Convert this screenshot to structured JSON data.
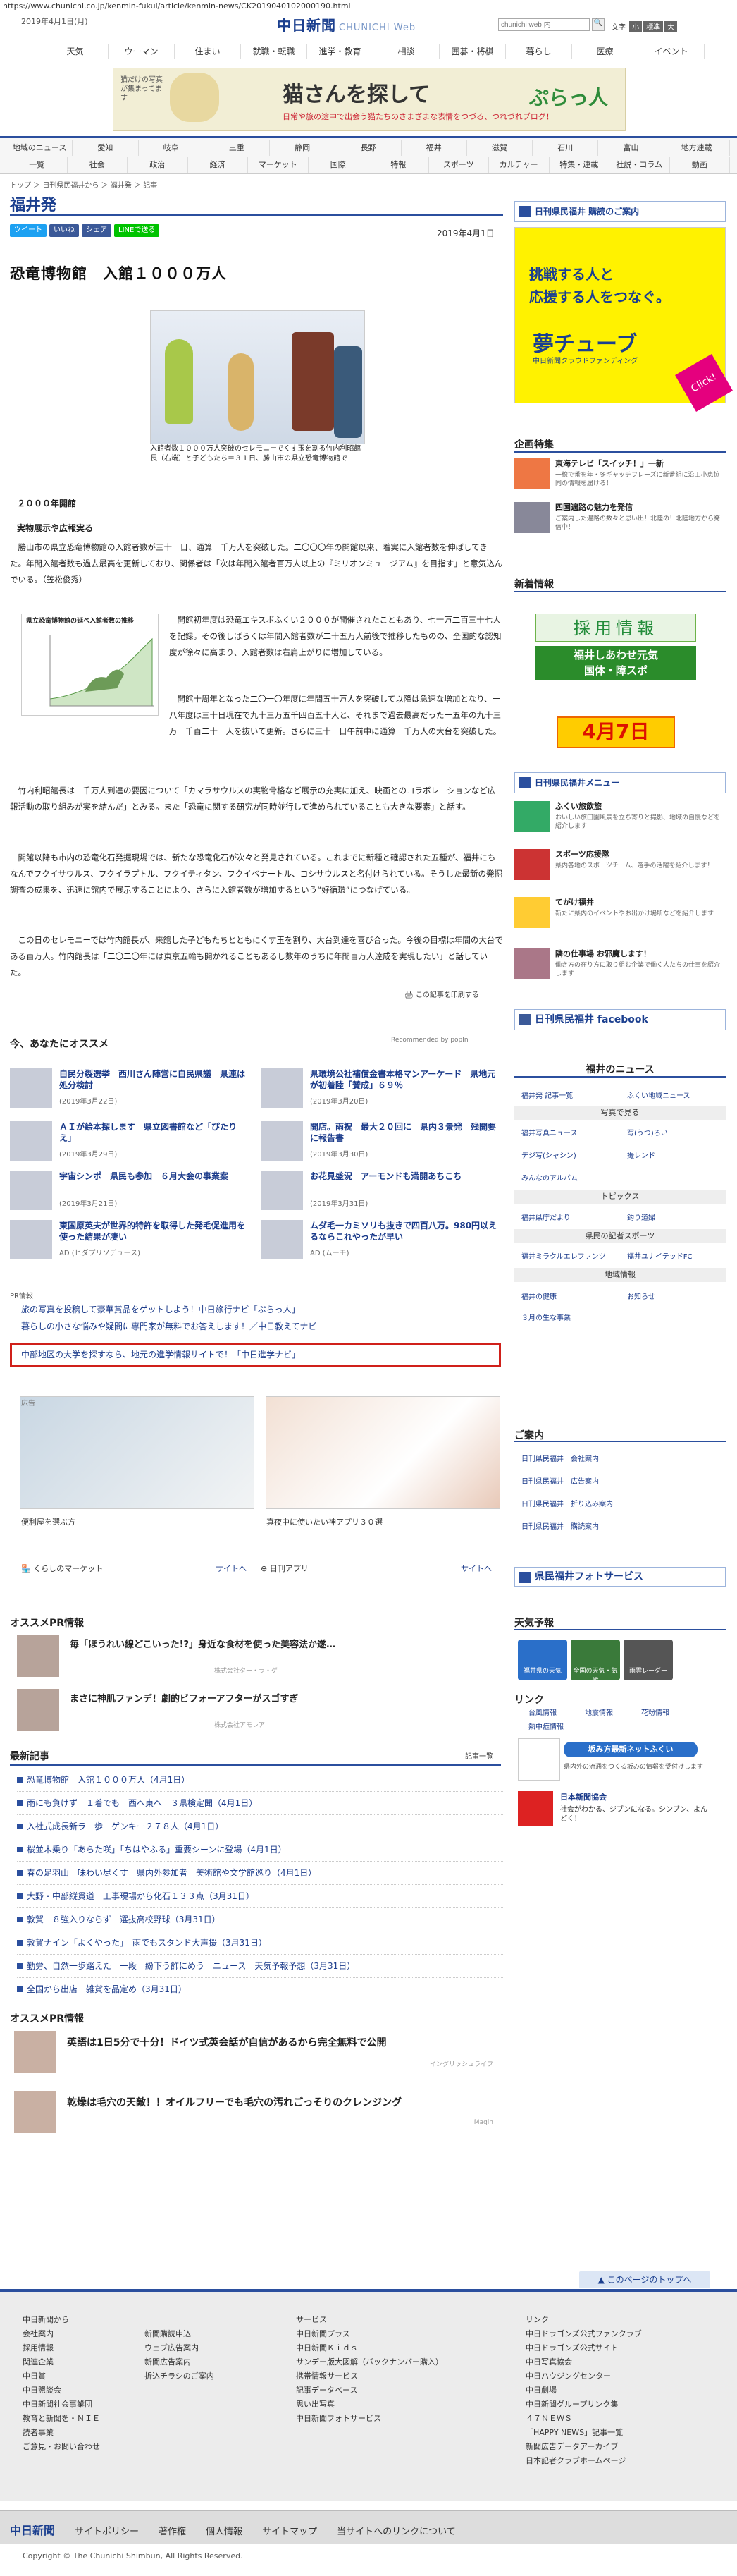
{
  "browser": {
    "url": "https://www.chunichi.co.jp/kenmin-fukui/article/kenmin-news/CK2019040102000190.html"
  },
  "header": {
    "date": "2019年4月1日(月)",
    "logo": "中日新聞",
    "logo_sub": "CHUNICHI Web",
    "search_placeholder": "chunichi web 内",
    "search_btn": "🔍",
    "font_size_label": "文字",
    "font_small": "小",
    "font_std": "標準",
    "font_large": "大",
    "nav": [
      "天気",
      "ウーマン",
      "住まい",
      "就職・転職",
      "進学・教育",
      "相談",
      "囲碁・将棋",
      "暮らし",
      "医療",
      "イベント"
    ]
  },
  "banner": {
    "badge": "猫だけの写真が集まってます",
    "title": "猫さんを探して",
    "sub": "日常や旅の途中で出会う猫たちのさまざまな表情をつづる、つれづれブログ！",
    "brand": "ぷらっ人"
  },
  "region_nav": {
    "row1": [
      "地域のニュース",
      "愛知",
      "岐阜",
      "三重",
      "静岡",
      "長野",
      "福井",
      "滋賀",
      "石川",
      "富山",
      "地方連載"
    ],
    "row2": [
      "一覧",
      "社会",
      "政治",
      "経済",
      "マーケット",
      "国際",
      "特報",
      "スポーツ",
      "カルチャー",
      "特集・連載",
      "社説・コラム",
      "動画"
    ]
  },
  "breadcrumb": "トップ ＞ 日刊県民福井から ＞ 福井発 ＞ 記事",
  "section": "福井発",
  "share": {
    "tweet": "ツイート",
    "like": "いいね",
    "share": "シェア",
    "line": "LINEで送る"
  },
  "article": {
    "date": "2019年4月1日",
    "title": "恐竜博物館　入館１０００万人",
    "caption": "入館者数１０００万人突破のセレモニーでくす玉を割る竹内利昭館長（右端）と子どもたち＝３１日、勝山市の県立恐竜博物館で",
    "sub1": "２０００年開館",
    "sub2": "実物展示や広報実る",
    "p1": "勝山市の県立恐竜博物館の入館者数が三十一日、通算一千万人を突破した。二〇〇〇年の開館以来、着実に入館者数を伸ばしてきた。年間入館者数も過去最高を更新しており、関係者は「次は年間入館者百万人以上の『ミリオンミュージアム』を目指す」と意気込んでいる。（笠松俊秀）",
    "graph_title": "県立恐竜博物館の延べ入館者数の推移",
    "p2": "開館初年度は恐竜エキスポふくい２０００が開催されたこともあり、七十万二百三十七人を記録。その後しばらくは年間入館者数が二十五万人前後で推移したものの、全国的な認知度が徐々に高まり、入館者数は右肩上がりに増加している。",
    "p3": "開館十周年となった二〇一〇年度に年間五十万人を突破して以降は急速な増加となり、一八年度は三十日現在で九十三万五千四百五十人と、それまで過去最高だった一五年の九十三万一千百二十一人を抜いて更新。さらに三十一日午前中に通算一千万人の大台を突破した。",
    "p4": "竹内利昭館長は一千万人到達の要因について「カマラサウルスの実物骨格など展示の充実に加え、映画とのコラボレーションなど広報活動の取り組みが実を結んだ」とみる。また「恐竜に関する研究が同時並行して進められていることも大きな要素」と話す。",
    "p5": "開館以降も市内の恐竜化石発掘現場では、新たな恐竜化石が次々と発見されている。これまでに新種と確認された五種が、福井にちなんでフクイサウルス、フクイラプトル、フクイティタン、フクイベナートル、コシサウルスと名付けられている。そうした最新の発掘調査の成果を、迅速に館内で展示することにより、さらに入館者数が増加するという“好循環”につなげている。",
    "p6": "この日のセレモニーでは竹内館長が、来館した子どもたちとともにくす玉を割り、大台到達を喜び合った。今後の目標は年間の大台である百万人。竹内館長は「二〇二〇年には東京五輪も開かれることもあるし数年のうちに年間百万人達成を実現したい」と話していた。",
    "print": "この記事を印刷する"
  },
  "recommend": {
    "title": "今、あなたにオススメ",
    "by": "Recommended by popIn",
    "items": [
      {
        "t": "自民分裂選挙　西川さん陣営に自民県議　県連は処分検討",
        "d": "(2019年3月22日)"
      },
      {
        "t": "県環境公社補償金書本格マンアーケード　県地元が初着陸「賛成」６９％",
        "d": "(2019年3月20日)"
      },
      {
        "t": "ＡＩが絵本探します　県立図書館など「ぴたりえ」",
        "d": "(2019年3月29日)"
      },
      {
        "t": "開店。雨祝　最大２０回に　県内３景発　残開要に報告書",
        "d": "(2019年3月30日)"
      },
      {
        "t": "宇宙シンポ　県民も参加　６月大会の事業案",
        "d": "(2019年3月21日)"
      },
      {
        "t": "お花見盛況　アーモンドも満開あちこち",
        "d": "(2019年3月31日)"
      },
      {
        "t": "東国原英夫が世界的特許を取得した発毛促進用を使った結果が凄い",
        "d": "AD (ヒダプリソデュース)"
      },
      {
        "t": "ムダ毛一カミソリも抜きで四百八万。980円以えるならこれやったが早い",
        "d": "AD (ムーモ)"
      }
    ]
  },
  "pr": {
    "label": "PR情報",
    "links": [
      "旅の写真を投稿して豪華賞品をゲットしよう！中日旅行ナビ「ぷらっ人」",
      "暮らしの小さな悩みや疑問に専門家が無料でお答えします！／中日教えてナビ",
      "中部地区の大学を探すなら、地元の進学情報サイトで！「中日進学ナビ」"
    ]
  },
  "ads": {
    "label": "広告",
    "cap1": "便利屋を選ぶ方",
    "cap2": "真夜中に使いたい神アプリ３０選",
    "market": "くらしのマーケット",
    "site1": "サイトへ",
    "app": "日刊アプリ",
    "site2": "サイトへ"
  },
  "osusume": {
    "title": "オススメPR情報",
    "items": [
      {
        "t": "毎「ほうれい線どこいった!?」身近な食材を使った美容法か遂…",
        "d": "株式会社ター・ラ・ゲ"
      },
      {
        "t": "まさに神肌ファンデ！劇的ビフォーアフターがスゴすぎ",
        "d": "株式会社アモレア"
      }
    ]
  },
  "latest": {
    "title": "最新記事",
    "more": "記事一覧",
    "items": [
      "恐竜博物館　入館１０００万人（4月1日）",
      "雨にも負けず　１着でも　西へ東へ　３県検定聞（4月1日）",
      "入社式成長新ラ一歩　ゲンキー２７８人（4月1日）",
      "桜並木乗り「あらた咲」「ちはやふる」重要シーンに登場（4月1日）",
      "春の足羽山　味わい尽くす　県内外参加者　美術館や文学館巡り（4月1日）",
      "大野・中部縦貫道　工事現場から化石１３３点（3月31日）",
      "敦賀　８強入りならず　選抜高校野球（3月31日）",
      "敦賀ナイン「よくやった」　雨でもスタンド大声援（3月31日）",
      "勤労、自然一歩踏えた　一段　紛下う飾にめう　ニュース　天気予報予想（3月31日）",
      "全国から出店　雑貨を品定め（3月31日）"
    ]
  },
  "osusume_pr": {
    "title": "オススメPR情報",
    "items": [
      {
        "t": "英語は1日5分で十分！ドイツ式英会話が自信があるから完全無料で公開",
        "d": "イングリッシュライフ"
      },
      {
        "t": "乾燥は毛穴の天敵！！オイルフリーでも毛穴の汚れごっそりのクレンジング",
        "d": "Maqin"
      }
    ]
  },
  "right": {
    "kodoku": "日刊県民福井 購読のご案内",
    "yume_t1": "挑戦する人と",
    "yume_t2": "応援する人をつなぐ。",
    "yume_logo": "夢チューブ",
    "yume_sub": "中日新聞クラウドファンディング",
    "yume_click": "Click!",
    "kikaku": "企画特集",
    "k1t": "東海テレビ「スイッチ！」一新",
    "k1s": "一線で番を年・冬ギャッチフレーズに新番組に沿工小恵協同の情報を届ける！",
    "k2t": "四国遍路の魅力を発信",
    "k2s": "ご案内した遍路の数々と思い出！北陸の！北陸地方から発信中！",
    "shinsai": "新着情報",
    "saiyo": "採用情報",
    "genki1": "福井しあわせ元気",
    "genki2": "国体・障スポ",
    "ap7": "4月7日",
    "menu": "日刊県民福井メニュー",
    "m": [
      {
        "t": "ふくい旅飲旅",
        "s": "おいしい旅田園風景を立ち寄りと撮影、地域の自慢などを紹介します"
      },
      {
        "t": "スポーツ応援隊",
        "s": "県内各地のスポーツチーム、選手の活躍を紹介します！"
      },
      {
        "t": "てがけ福井",
        "s": "新たに県内のイベントやお出かけ場所などを紹介します"
      },
      {
        "t": "隣の仕事場 お邪魔します！",
        "s": "働き方の在り方に取り組む企業で働く人たちの仕事を紹介します"
      }
    ],
    "facebook": "日刊県民福井 facebook",
    "fnews": "福井のニュース",
    "g": [
      "福井発 記事一覧",
      "ふくい地域ニュース"
    ],
    "g_photo": "写真で見る",
    "g2": [
      "福井写真ニュース",
      "写(うつ)ろい"
    ],
    "g3": [
      "デジ写(シャシン)",
      "撮レンド"
    ],
    "g4": "みんなのアルバム",
    "topics": "トピックス",
    "t1": "福井県庁だより",
    "t2": "釣り道婦",
    "sports": "県民の記者スポーツ",
    "sp1": "福井ミラクルエレファンツ",
    "sp2": "福井ユナイテッドFC",
    "chiiki": "地域情報",
    "c1": "福井の健康",
    "c2": "お知らせ",
    "c3": "３月の生な事業",
    "annai": "ご案内",
    "a": [
      "日刊県民福井　会社案内",
      "日刊県民福井　広告案内",
      "日刊県民福井　折り込み案内",
      "日刊県民福井　購読案内"
    ],
    "photo_service": "県民福井フォトサービス",
    "tenki": "天気予報",
    "w": [
      "福井県の天気",
      "全国の天気・気候",
      "雨雲レーダー"
    ],
    "link": "リンク",
    "l": [
      "台風情報",
      "地震情報",
      "花粉情報",
      "熱中症情報"
    ],
    "sakemichi": "坂み方最新ネットふくい",
    "sakemichi_s": "県内外の流通をつくる坂みの情報を受付けします",
    "nihon": "日本新聞協会",
    "nihon_s": "社会がわかる、ジブンになる。シンブン、よんどく！"
  },
  "footer": {
    "top": "このページのトップへ",
    "c1": [
      "中日新聞から",
      "会社案内",
      "採用情報",
      "関連企業",
      "中日賞",
      "中日懇談会",
      "中日新聞社会事業団",
      "教育と新聞を・ＮＩＥ",
      "読者事業",
      "ご意見・お問い合わせ"
    ],
    "c2": [
      "",
      "新聞購読申込",
      "ウェブ広告案内",
      "新聞広告案内",
      "折込チラシのご案内"
    ],
    "c3": [
      "サービス",
      "中日新聞プラス",
      "中日新聞Ｋｉｄｓ",
      "サンデー版大図解（バックナンバー購入）",
      "携帯情報サービス",
      "記事データベース",
      "思い出写真",
      "中日新聞フォトサービス"
    ],
    "c4": [
      "リンク",
      "中日ドラゴンズ公式ファンクラブ",
      "中日ドラゴンズ公式サイト",
      "中日写真協会",
      "中日ハウジングセンター",
      "中日劇場",
      "中日新聞グループリンク集",
      "４７ＮＥＷＳ",
      "「HAPPY NEWS」記事一覧",
      "新聞広告データアーカイブ",
      "日本記者クラブホームページ"
    ],
    "bar": [
      "中日新聞",
      "サイトポリシー",
      "著作権",
      "個人情報",
      "サイトマップ",
      "当サイトへのリンクについて"
    ],
    "copyright": "Copyright © The Chunichi Shimbun, All Rights Reserved."
  },
  "colors": {
    "brand": "#1b3f8f",
    "highlight": "#d0201a",
    "yume": "#fff200"
  },
  "chart_data": {
    "type": "line",
    "title": "県立恐竜博物館の延べ入館者数の推移",
    "series": [
      {
        "values": []
      }
    ]
  }
}
